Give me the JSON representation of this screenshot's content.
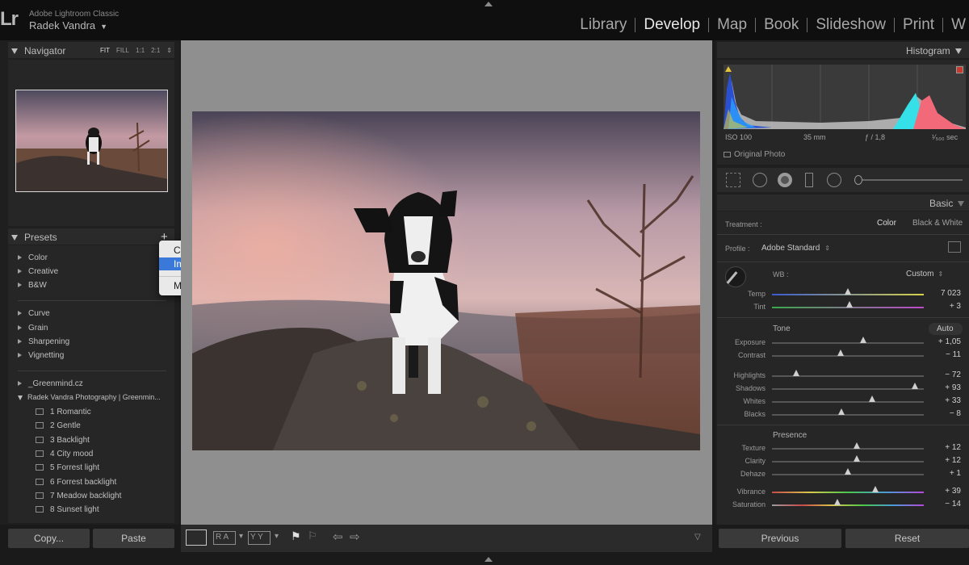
{
  "app": {
    "name": "Adobe Lightroom Classic",
    "user": "Radek Vandra",
    "logo": "Lr",
    "modules": [
      "Library",
      "Develop",
      "Map",
      "Book",
      "Slideshow",
      "Print",
      "W"
    ],
    "active_module": "Develop"
  },
  "navigator": {
    "title": "Navigator",
    "options": [
      "FIT",
      "FILL",
      "1:1",
      "2:1"
    ]
  },
  "presets": {
    "title": "Presets",
    "plus": "+",
    "groups_a": [
      "Color",
      "Creative",
      "B&W"
    ],
    "groups_b": [
      "Curve",
      "Grain",
      "Sharpening",
      "Vignetting"
    ],
    "groups_c": [
      "_Greenmind.cz",
      "Radek Vandra Photography | Greenmin..."
    ],
    "user_presets": [
      "1 Romantic",
      "2 Gentle",
      "3 Backlight",
      "4 City mood",
      "5 Forrest light",
      "6 Forrest backlight",
      "7 Meadow backlight",
      "8 Sunset light"
    ]
  },
  "context_menu": {
    "items": [
      "Create Preset...",
      "Import Presets...",
      "Manage Presets..."
    ],
    "selected": "Import Presets..."
  },
  "buttons": {
    "copy": "Copy...",
    "paste": "Paste",
    "previous": "Previous",
    "reset": "Reset"
  },
  "toolbar": {
    "rating_a": "R A",
    "rating_b": "Y Y"
  },
  "histogram": {
    "title": "Histogram",
    "iso": "ISO 100",
    "focal": "35 mm",
    "aperture": "ƒ / 1,8",
    "shutter": "¹⁄₅₀₀ sec",
    "original_photo": "Original Photo"
  },
  "basic": {
    "title": "Basic",
    "treatment_label": "Treatment :",
    "treatment_color": "Color",
    "treatment_bw": "Black & White",
    "profile_label": "Profile :",
    "profile_value": "Adobe Standard",
    "wb_label": "WB :",
    "wb_value": "Custom",
    "tone_label": "Tone",
    "auto_label": "Auto",
    "presence_label": "Presence",
    "sliders": [
      {
        "name": "Temp",
        "value": "7 023",
        "pos": 0.5
      },
      {
        "name": "Tint",
        "value": "+ 3",
        "pos": 0.51
      },
      {
        "name": "Exposure",
        "value": "+ 1,05",
        "pos": 0.6
      },
      {
        "name": "Contrast",
        "value": "− 11",
        "pos": 0.45
      },
      {
        "name": "Highlights",
        "value": "− 72",
        "pos": 0.16
      },
      {
        "name": "Shadows",
        "value": "+ 93",
        "pos": 0.94
      },
      {
        "name": "Whites",
        "value": "+ 33",
        "pos": 0.66
      },
      {
        "name": "Blacks",
        "value": "− 8",
        "pos": 0.46
      },
      {
        "name": "Texture",
        "value": "+ 12",
        "pos": 0.56
      },
      {
        "name": "Clarity",
        "value": "+ 12",
        "pos": 0.56
      },
      {
        "name": "Dehaze",
        "value": "+ 1",
        "pos": 0.5
      },
      {
        "name": "Vibrance",
        "value": "+ 39",
        "pos": 0.68
      },
      {
        "name": "Saturation",
        "value": "− 14",
        "pos": 0.43
      }
    ]
  }
}
